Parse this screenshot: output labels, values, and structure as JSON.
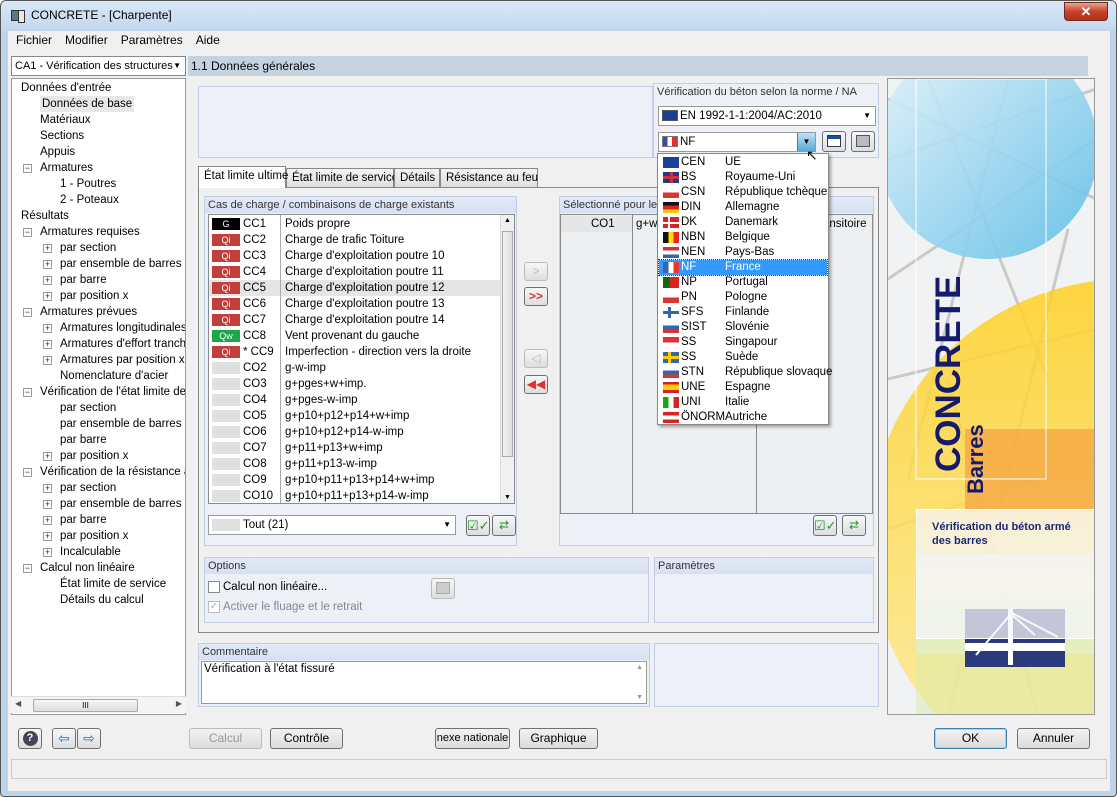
{
  "window": {
    "title": "CONCRETE - [Charpente]",
    "close_icon": "close-icon"
  },
  "menu": [
    "Fichier",
    "Modifier",
    "Paramètres",
    "Aide"
  ],
  "case_selector": {
    "value": "CA1 - Vérification des structures"
  },
  "page_header": "1.1 Données générales",
  "tree": [
    {
      "label": "Données d'entrée",
      "level": 0,
      "toggle": ""
    },
    {
      "label": "Données de base",
      "level": 1,
      "toggle": "",
      "selected": true
    },
    {
      "label": "Matériaux",
      "level": 1,
      "toggle": ""
    },
    {
      "label": "Sections",
      "level": 1,
      "toggle": ""
    },
    {
      "label": "Appuis",
      "level": 1,
      "toggle": ""
    },
    {
      "label": "Armatures",
      "level": 1,
      "toggle": "-"
    },
    {
      "label": "1 - Poutres",
      "level": 2,
      "toggle": ""
    },
    {
      "label": "2 - Poteaux",
      "level": 2,
      "toggle": ""
    },
    {
      "label": "Résultats",
      "level": 0,
      "toggle": ""
    },
    {
      "label": "Armatures requises",
      "level": 1,
      "toggle": "-"
    },
    {
      "label": "par section",
      "level": 2,
      "toggle": "+"
    },
    {
      "label": "par ensemble de barres",
      "level": 2,
      "toggle": "+"
    },
    {
      "label": "par barre",
      "level": 2,
      "toggle": "+"
    },
    {
      "label": "par position x",
      "level": 2,
      "toggle": "+"
    },
    {
      "label": "Armatures prévues",
      "level": 1,
      "toggle": "-"
    },
    {
      "label": "Armatures longitudinales",
      "level": 2,
      "toggle": "+"
    },
    {
      "label": "Armatures d'effort tranchant",
      "level": 2,
      "toggle": "+"
    },
    {
      "label": "Armatures par position x",
      "level": 2,
      "toggle": "+"
    },
    {
      "label": "Nomenclature d'acier",
      "level": 2,
      "toggle": ""
    },
    {
      "label": "Vérification de l'état limite de service",
      "level": 1,
      "toggle": "-"
    },
    {
      "label": "par section",
      "level": 2,
      "toggle": ""
    },
    {
      "label": "par ensemble de barres",
      "level": 2,
      "toggle": ""
    },
    {
      "label": "par barre",
      "level": 2,
      "toggle": ""
    },
    {
      "label": "par position x",
      "level": 2,
      "toggle": "+"
    },
    {
      "label": "Vérification de la résistance au feu",
      "level": 1,
      "toggle": "-"
    },
    {
      "label": "par section",
      "level": 2,
      "toggle": "+"
    },
    {
      "label": "par ensemble de barres",
      "level": 2,
      "toggle": "+"
    },
    {
      "label": "par barre",
      "level": 2,
      "toggle": "+"
    },
    {
      "label": "par position x",
      "level": 2,
      "toggle": "+"
    },
    {
      "label": "Incalculable",
      "level": 2,
      "toggle": "+"
    },
    {
      "label": "Calcul non linéaire",
      "level": 1,
      "toggle": "-"
    },
    {
      "label": "État limite de service",
      "level": 2,
      "toggle": ""
    },
    {
      "label": "Détails du calcul",
      "level": 2,
      "toggle": ""
    }
  ],
  "norm": {
    "title": "Vérification du béton selon la norme / NA",
    "standard": "EN 1992-1-1:2004/AC:2010",
    "annex": "NF",
    "options": [
      {
        "abbr": "CEN",
        "name": "UE",
        "flag": "eu"
      },
      {
        "abbr": "BS",
        "name": "Royaume-Uni",
        "flag": "uk"
      },
      {
        "abbr": "CSN",
        "name": "République tchèque",
        "flag": "cz"
      },
      {
        "abbr": "DIN",
        "name": "Allemagne",
        "flag": "de"
      },
      {
        "abbr": "DK",
        "name": "Danemark",
        "flag": "dk"
      },
      {
        "abbr": "NBN",
        "name": "Belgique",
        "flag": "be"
      },
      {
        "abbr": "NEN",
        "name": "Pays-Bas",
        "flag": "nl"
      },
      {
        "abbr": "NF",
        "name": "France",
        "flag": "fr",
        "selected": true
      },
      {
        "abbr": "NP",
        "name": "Portugal",
        "flag": "pt"
      },
      {
        "abbr": "PN",
        "name": "Pologne",
        "flag": "pl"
      },
      {
        "abbr": "SFS",
        "name": "Finlande",
        "flag": "fi"
      },
      {
        "abbr": "SIST",
        "name": "Slovénie",
        "flag": "si"
      },
      {
        "abbr": "SS",
        "name": "Singapour",
        "flag": "sg"
      },
      {
        "abbr": "SS",
        "name": "Suède",
        "flag": "se"
      },
      {
        "abbr": "STN",
        "name": "République slovaque",
        "flag": "sk"
      },
      {
        "abbr": "UNE",
        "name": "Espagne",
        "flag": "es"
      },
      {
        "abbr": "UNI",
        "name": "Italie",
        "flag": "it"
      },
      {
        "abbr": "ÖNORM",
        "name": "Autriche",
        "flag": "at"
      }
    ]
  },
  "tabs": [
    "État limite ultime",
    "État limite de service",
    "Détails",
    "Résistance au feu"
  ],
  "existing": {
    "title": "Cas de charge / combinaisons de charge existants",
    "rows": [
      {
        "badge": "G",
        "color": "#000000",
        "code": "CC1",
        "desc": "Poids propre"
      },
      {
        "badge": "Qi",
        "color": "#c0403c",
        "code": "CC2",
        "desc": "Charge de trafic Toiture"
      },
      {
        "badge": "Qi",
        "color": "#c0403c",
        "code": "CC3",
        "desc": "Charge d'exploitation poutre 10"
      },
      {
        "badge": "Qi",
        "color": "#c0403c",
        "code": "CC4",
        "desc": "Charge d'exploitation poutre 11"
      },
      {
        "badge": "Qi",
        "color": "#c0403c",
        "code": "CC5",
        "desc": "Charge d'exploitation poutre 12",
        "selected": true
      },
      {
        "badge": "Qi",
        "color": "#c0403c",
        "code": "CC6",
        "desc": "Charge d'exploitation poutre 13"
      },
      {
        "badge": "Qi",
        "color": "#c0403c",
        "code": "CC7",
        "desc": "Charge d'exploitation poutre 14"
      },
      {
        "badge": "Qw",
        "color": "#1aa84a",
        "code": "CC8",
        "desc": "Vent provenant du gauche"
      },
      {
        "badge": "Qi",
        "color": "#c0403c",
        "code": "* CC9",
        "desc": "Imperfection - direction vers la droite"
      },
      {
        "badge": "",
        "color": "#e0e0e0",
        "code": "CO2",
        "desc": "g-w-imp"
      },
      {
        "badge": "",
        "color": "#e0e0e0",
        "code": "CO3",
        "desc": "g+pges+w+imp."
      },
      {
        "badge": "",
        "color": "#e0e0e0",
        "code": "CO4",
        "desc": "g+pges-w-imp"
      },
      {
        "badge": "",
        "color": "#e0e0e0",
        "code": "CO5",
        "desc": "g+p10+p12+p14+w+imp"
      },
      {
        "badge": "",
        "color": "#e0e0e0",
        "code": "CO6",
        "desc": "g+p10+p12+p14-w-imp"
      },
      {
        "badge": "",
        "color": "#e0e0e0",
        "code": "CO7",
        "desc": "g+p11+p13+w+imp"
      },
      {
        "badge": "",
        "color": "#e0e0e0",
        "code": "CO8",
        "desc": "g+p11+p13-w-imp"
      },
      {
        "badge": "",
        "color": "#e0e0e0",
        "code": "CO9",
        "desc": "g+p10+p11+p13+p14+w+imp"
      },
      {
        "badge": "",
        "color": "#e0e0e0",
        "code": "CO10",
        "desc": "g+p10+p11+p13+p14-w-imp"
      }
    ],
    "filter": "Tout (21)"
  },
  "selected": {
    "title": "Sélectionné pour le c",
    "rows": [
      {
        "code": "CO1",
        "desc": "g+w-",
        "extra": "ansitoire"
      }
    ]
  },
  "options": {
    "title": "Options",
    "nonlinear": "Calcul non linéaire...",
    "creep": "Activer le fluage et le retrait"
  },
  "parameters": {
    "title": "Paramètres"
  },
  "comment": {
    "title": "Commentaire",
    "value": "Vérification à l'état fissuré"
  },
  "banner": {
    "product": "CONCRETE",
    "module": "Barres",
    "description": "Vérification du béton armé des barres"
  },
  "buttons": {
    "calcul": "Calcul",
    "controle": "Contrôle",
    "annexe": "nexe nationale",
    "graphique": "Graphique",
    "ok": "OK",
    "annuler": "Annuler"
  }
}
